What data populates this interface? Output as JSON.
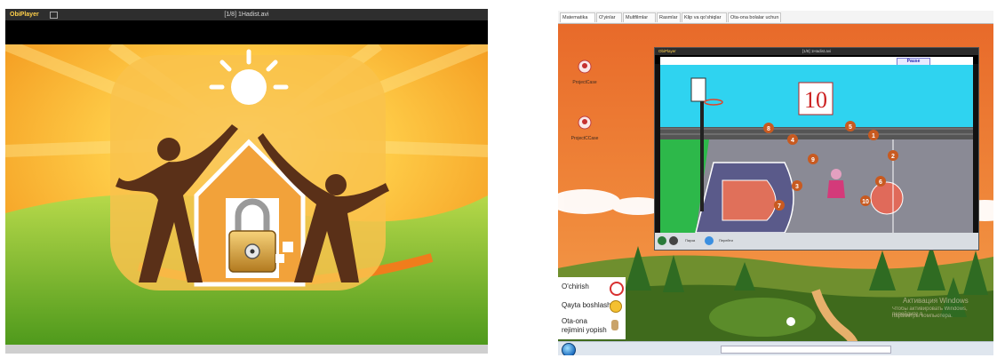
{
  "left_window": {
    "app_name": "ObiPlayer",
    "file_title": "[1/8] 1Hadist.avi",
    "icons": [
      "lock-icon",
      "sun-icon",
      "family-figures-icon"
    ]
  },
  "right_window": {
    "tabs": [
      {
        "label": "Matematika",
        "active": true
      },
      {
        "label": "O'yinlar",
        "active": false
      },
      {
        "label": "Multfilmlar",
        "active": false
      },
      {
        "label": "Rasmlar",
        "active": false
      },
      {
        "label": "Klip va qo'shiqlar",
        "active": false
      },
      {
        "label": "Ota-ona bolalar uchun",
        "active": false
      }
    ],
    "desktop_icons": [
      {
        "label": "ProjectCase",
        "icon": "pin-icon"
      },
      {
        "label": "ProjectCCase",
        "icon": "pin-icon"
      }
    ],
    "player": {
      "app_name": "ObiPlayer",
      "file_title": "[1/8] 1Hadist.avi",
      "pause_label": "Pause",
      "controls": [
        "Пауза",
        "Перейти"
      ]
    },
    "game": {
      "target_number": "10",
      "balls": [
        "8",
        "4",
        "5",
        "1",
        "9",
        "2",
        "3",
        "6",
        "10",
        "7"
      ]
    },
    "menu": {
      "items": [
        {
          "label": "O'chirish",
          "icon": "power-icon"
        },
        {
          "label": "Qayta boshlash",
          "icon": "restart-icon"
        },
        {
          "label": "Ota-ona rejimini yopish",
          "icon": "key-icon"
        }
      ]
    },
    "watermark": {
      "line1": "Активация Windows",
      "line2": "Чтобы активировать Windows, перейдите в",
      "line3": "параметры компьютера."
    }
  }
}
